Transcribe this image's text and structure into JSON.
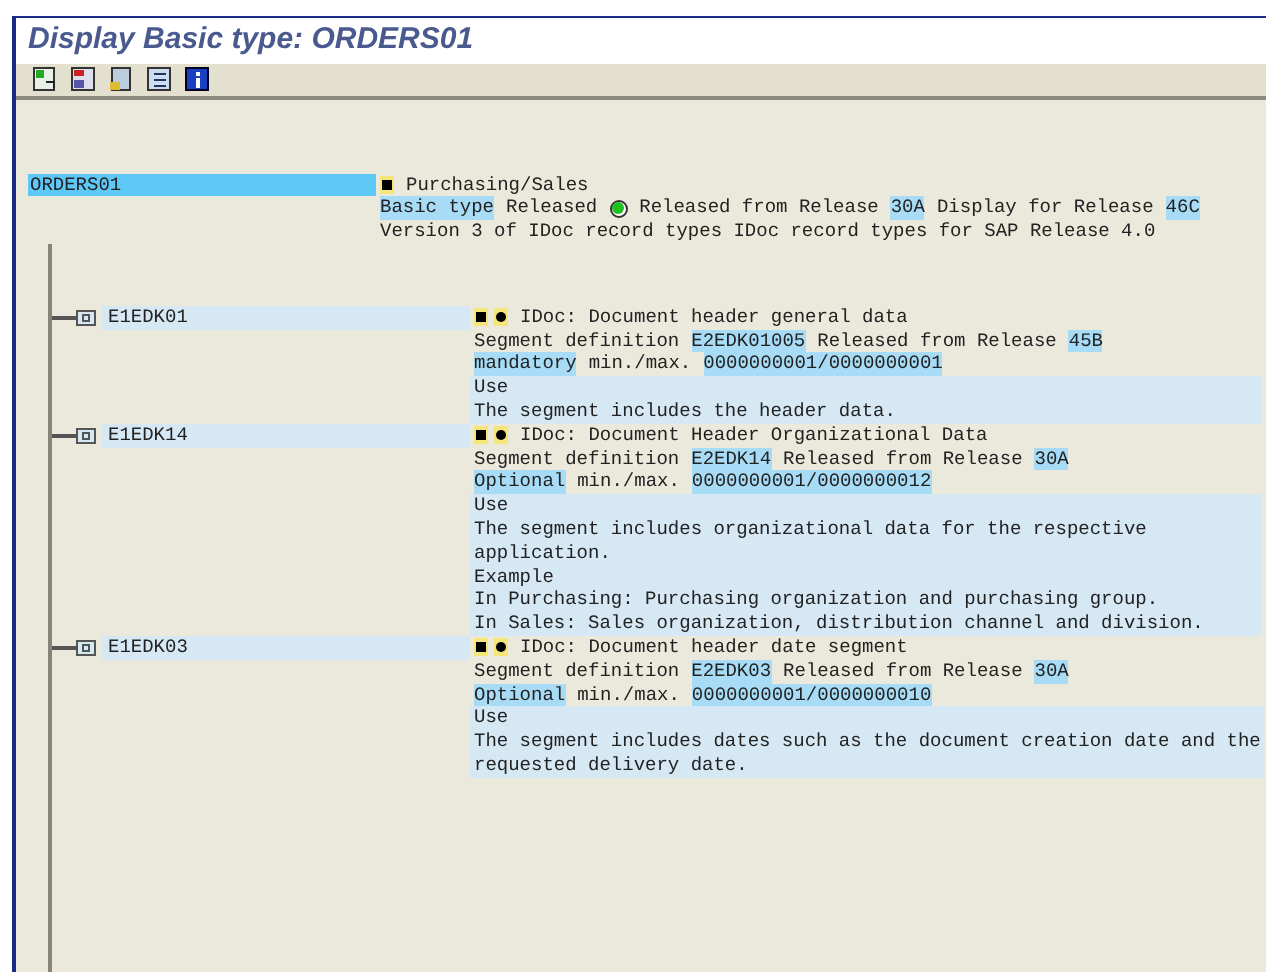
{
  "window": {
    "title": "Display Basic type: ORDERS01"
  },
  "toolbar": {
    "buttons": [
      {
        "kind": "insert"
      },
      {
        "kind": "move"
      },
      {
        "kind": "segment"
      },
      {
        "kind": "list"
      },
      {
        "kind": "info"
      }
    ]
  },
  "root": {
    "label": "ORDERS01",
    "selected": true,
    "lines": [
      {
        "kind": "heading",
        "markers": [
          {
            "kind": "square"
          }
        ],
        "parts": [
          {
            "text": "Purchasing/Sales",
            "highlight": false
          }
        ],
        "shaded": false
      },
      {
        "kind": "text",
        "parts": [
          {
            "text": "Basic type",
            "highlight": true
          },
          {
            "text": "Released",
            "highlight": false
          },
          {
            "kind": "status",
            "on": true
          },
          {
            "text": "Released from Release",
            "highlight": false
          },
          {
            "text": "30A",
            "highlight": true
          },
          {
            "text": "Display for Release",
            "highlight": false
          },
          {
            "text": "46C",
            "highlight": true
          }
        ],
        "shaded": false
      },
      {
        "kind": "text",
        "parts": [
          {
            "text": "Version 3 of IDoc record types IDoc record types for SAP Release 4.0",
            "highlight": false
          }
        ],
        "shaded": false
      }
    ]
  },
  "segments": [
    {
      "label": "E1EDK01",
      "selected": false,
      "lines": [
        {
          "kind": "heading",
          "markers": [
            {
              "kind": "square"
            },
            {
              "kind": "dot"
            }
          ],
          "parts": [
            {
              "text": "IDoc: Document header general data",
              "highlight": false
            }
          ],
          "shaded": false
        },
        {
          "kind": "text",
          "parts": [
            {
              "text": "Segment definition",
              "highlight": false
            },
            {
              "text": "E2EDK01005",
              "highlight": true
            },
            {
              "text": "Released from Release",
              "highlight": false
            },
            {
              "text": "45B",
              "highlight": true
            }
          ],
          "shaded": false
        },
        {
          "kind": "text",
          "parts": [
            {
              "text": "mandatory",
              "highlight": true
            },
            {
              "text": "min./max.",
              "highlight": false
            },
            {
              "text": "0000000001/0000000001",
              "highlight": true
            }
          ],
          "shaded": false
        },
        {
          "kind": "text",
          "parts": [
            {
              "text": "Use",
              "highlight": false
            }
          ],
          "shaded": true
        },
        {
          "kind": "text",
          "parts": [
            {
              "text": "The segment includes the header data.",
              "highlight": false
            }
          ],
          "shaded": true
        }
      ]
    },
    {
      "label": "E1EDK14",
      "selected": false,
      "lines": [
        {
          "kind": "heading",
          "markers": [
            {
              "kind": "square"
            },
            {
              "kind": "dot"
            }
          ],
          "parts": [
            {
              "text": "IDoc: Document Header Organizational Data",
              "highlight": false
            }
          ],
          "shaded": false
        },
        {
          "kind": "text",
          "parts": [
            {
              "text": "Segment definition",
              "highlight": false
            },
            {
              "text": "E2EDK14",
              "highlight": true
            },
            {
              "text": "Released from Release",
              "highlight": false
            },
            {
              "text": "30A",
              "highlight": true
            }
          ],
          "shaded": false
        },
        {
          "kind": "text",
          "parts": [
            {
              "text": "Optional",
              "highlight": true
            },
            {
              "text": "min./max.",
              "highlight": false
            },
            {
              "text": "0000000001/0000000012",
              "highlight": true
            }
          ],
          "shaded": false
        },
        {
          "kind": "text",
          "parts": [
            {
              "text": "Use",
              "highlight": false
            }
          ],
          "shaded": true
        },
        {
          "kind": "text",
          "parts": [
            {
              "text": "The segment includes organizational data for the respective",
              "highlight": false
            }
          ],
          "shaded": true
        },
        {
          "kind": "text",
          "parts": [
            {
              "text": "application.",
              "highlight": false
            }
          ],
          "shaded": true
        },
        {
          "kind": "text",
          "parts": [
            {
              "text": "Example",
              "highlight": false
            }
          ],
          "shaded": true
        },
        {
          "kind": "text",
          "parts": [
            {
              "text": "In Purchasing: Purchasing organization and purchasing group.",
              "highlight": false
            }
          ],
          "shaded": true
        },
        {
          "kind": "text",
          "parts": [
            {
              "text": "In Sales: Sales organization, distribution channel and division.",
              "highlight": false
            }
          ],
          "shaded": true
        }
      ]
    },
    {
      "label": "E1EDK03",
      "selected": false,
      "lines": [
        {
          "kind": "heading",
          "markers": [
            {
              "kind": "square"
            },
            {
              "kind": "dot"
            }
          ],
          "parts": [
            {
              "text": "IDoc: Document header date segment",
              "highlight": false
            }
          ],
          "shaded": false
        },
        {
          "kind": "text",
          "parts": [
            {
              "text": "Segment definition",
              "highlight": false
            },
            {
              "text": "E2EDK03",
              "highlight": true
            },
            {
              "text": "Released from Release",
              "highlight": false
            },
            {
              "text": "30A",
              "highlight": true
            }
          ],
          "shaded": false
        },
        {
          "kind": "text",
          "parts": [
            {
              "text": "Optional",
              "highlight": true
            },
            {
              "text": "min./max.",
              "highlight": false
            },
            {
              "text": "0000000001/0000000010",
              "highlight": true
            }
          ],
          "shaded": false
        },
        {
          "kind": "text",
          "parts": [
            {
              "text": "Use",
              "highlight": false
            }
          ],
          "shaded": true
        },
        {
          "kind": "text",
          "parts": [
            {
              "text": "The segment includes dates such as the document creation date and the",
              "highlight": false
            }
          ],
          "shaded": true
        },
        {
          "kind": "text",
          "parts": [
            {
              "text": "requested delivery date.",
              "highlight": false
            }
          ],
          "shaded": true
        }
      ]
    }
  ]
}
